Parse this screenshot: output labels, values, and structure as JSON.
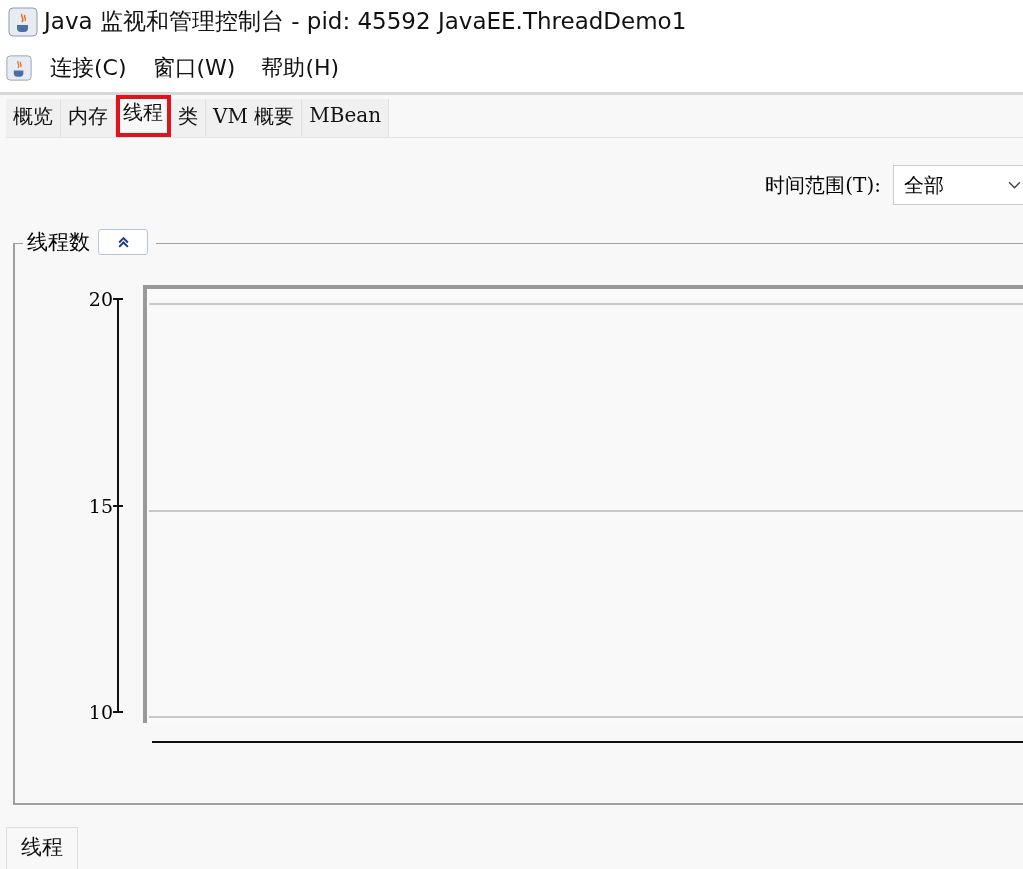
{
  "window": {
    "title": "Java 监视和管理控制台 - pid: 45592 JavaEE.ThreadDemo1"
  },
  "menu": [
    "连接(C)",
    "窗口(W)",
    "帮助(H)"
  ],
  "tabs": [
    {
      "label": "概览",
      "selected": false,
      "highlighted": false
    },
    {
      "label": "内存",
      "selected": false,
      "highlighted": false
    },
    {
      "label": "线程",
      "selected": true,
      "highlighted": true
    },
    {
      "label": "类",
      "selected": false,
      "highlighted": false
    },
    {
      "label": "VM 概要",
      "selected": false,
      "highlighted": false
    },
    {
      "label": "MBean",
      "selected": false,
      "highlighted": false
    }
  ],
  "time_range": {
    "label": "时间范围(T):",
    "value": "全部"
  },
  "thread_count_panel": {
    "title": "线程数",
    "expanded": true,
    "y_ticks": [
      "20",
      "15",
      "10"
    ]
  },
  "bottom_tabs": [
    {
      "label": "线程",
      "selected": true
    }
  ]
}
